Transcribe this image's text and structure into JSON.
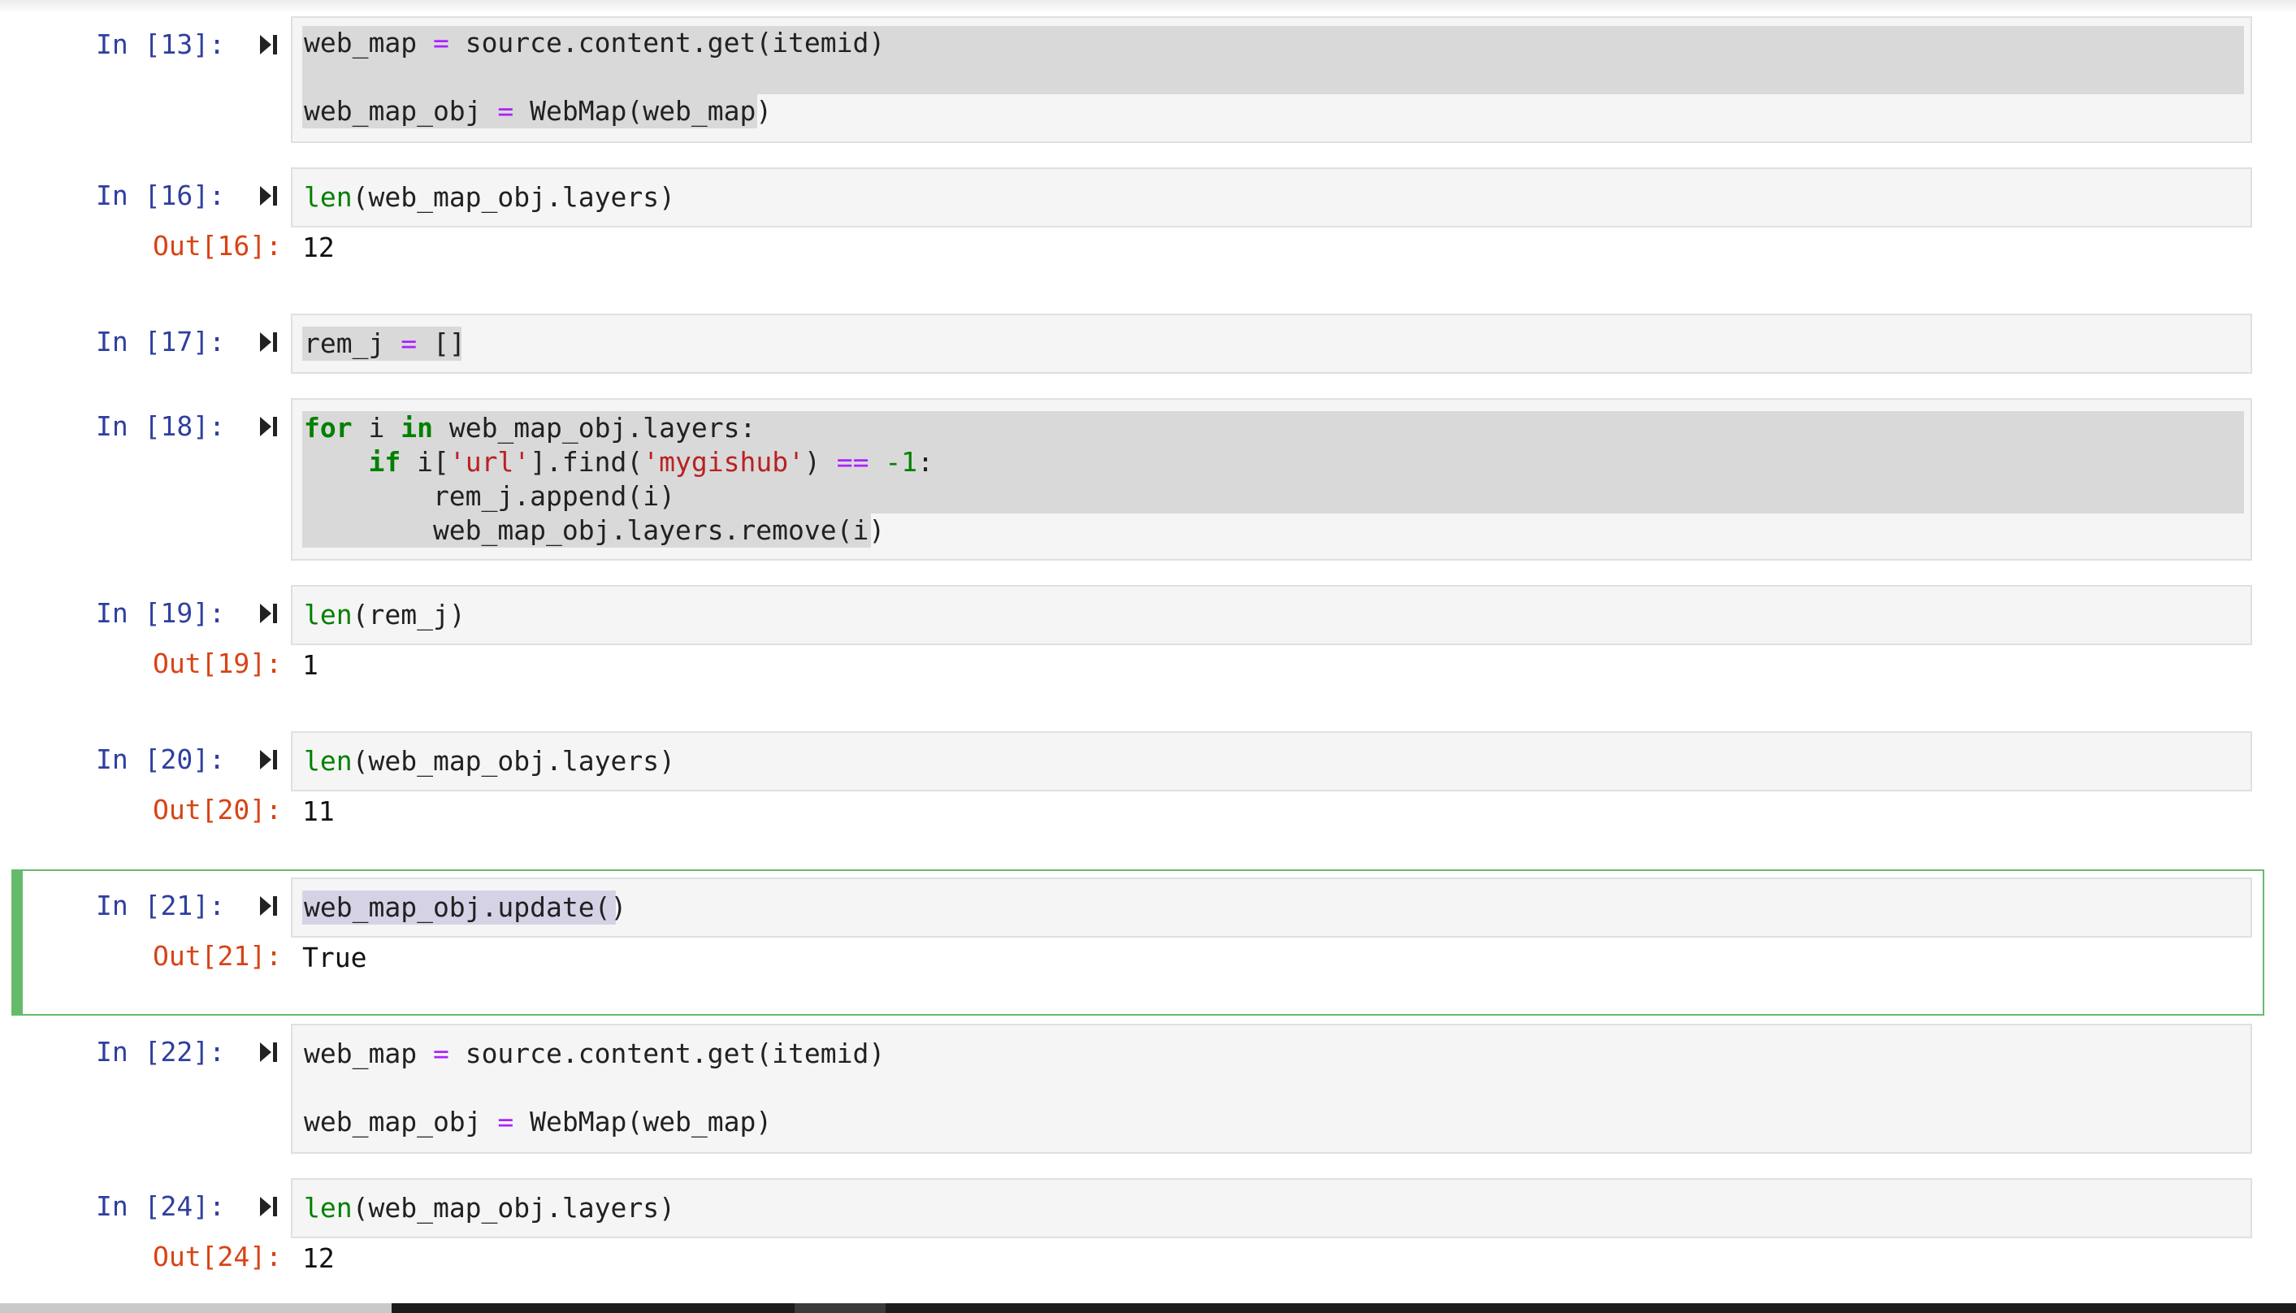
{
  "cells": [
    {
      "in_prompt": "In [13]:",
      "lines": [
        [
          [
            "web_map ",
            ""
          ],
          [
            "=",
            "op"
          ],
          [
            " source.content.get(itemid)",
            ""
          ]
        ],
        [
          [
            "",
            ""
          ]
        ],
        [
          [
            "web_map_obj ",
            ""
          ],
          [
            "=",
            "op"
          ],
          [
            " WebMap(web_map)",
            ""
          ]
        ]
      ]
    },
    {
      "in_prompt": "In [16]:",
      "lines": [
        [
          [
            "len",
            "bi"
          ],
          [
            "(web_map_obj.layers)",
            ""
          ]
        ]
      ],
      "out_prompt": "Out[16]:",
      "output": "12"
    },
    {
      "in_prompt": "In [17]:",
      "lines": [
        [
          [
            "rem_j ",
            ""
          ],
          [
            "=",
            "op"
          ],
          [
            " []",
            ""
          ]
        ]
      ]
    },
    {
      "in_prompt": "In [18]:",
      "lines": [
        [
          [
            "for",
            "kw"
          ],
          [
            " i ",
            ""
          ],
          [
            "in",
            "kw"
          ],
          [
            " web_map_obj.layers:",
            ""
          ]
        ],
        [
          [
            "    ",
            ""
          ],
          [
            "if",
            "kw"
          ],
          [
            " i[",
            ""
          ],
          [
            "'url'",
            "str"
          ],
          [
            "].find(",
            ""
          ],
          [
            "'mygishub'",
            "str"
          ],
          [
            ") ",
            ""
          ],
          [
            "==",
            "op"
          ],
          [
            " ",
            ""
          ],
          [
            "-1",
            "num"
          ],
          [
            ":",
            ""
          ]
        ],
        [
          [
            "        rem_j.append(i)",
            ""
          ]
        ],
        [
          [
            "        web_map_obj.layers.remove(i)",
            ""
          ]
        ]
      ]
    },
    {
      "in_prompt": "In [19]:",
      "lines": [
        [
          [
            "len",
            "bi"
          ],
          [
            "(rem_j)",
            ""
          ]
        ]
      ],
      "out_prompt": "Out[19]:",
      "output": "1"
    },
    {
      "in_prompt": "In [20]:",
      "lines": [
        [
          [
            "len",
            "bi"
          ],
          [
            "(web_map_obj.layers)",
            ""
          ]
        ]
      ],
      "out_prompt": "Out[20]:",
      "output": "11"
    },
    {
      "in_prompt": "In [21]:",
      "lines": [
        [
          [
            "web_map_obj.update()",
            ""
          ]
        ]
      ],
      "out_prompt": "Out[21]:",
      "output": "True"
    },
    {
      "in_prompt": "In [22]:",
      "lines": [
        [
          [
            "web_map ",
            ""
          ],
          [
            "=",
            "op"
          ],
          [
            " source.content.get(itemid)",
            ""
          ]
        ],
        [
          [
            "",
            ""
          ]
        ],
        [
          [
            "web_map_obj ",
            ""
          ],
          [
            "=",
            "op"
          ],
          [
            " WebMap(web_map)",
            ""
          ]
        ]
      ]
    },
    {
      "in_prompt": "In [24]:",
      "lines": [
        [
          [
            "len",
            "bi"
          ],
          [
            "(web_map_obj.layers)",
            ""
          ]
        ]
      ],
      "out_prompt": "Out[24]:",
      "output": "12"
    }
  ],
  "colors": {
    "in_prompt": "#303f9f",
    "out_prompt": "#d84315",
    "selected_cell_border": "#66bb6a",
    "operator": "#aa22ff",
    "keyword": "#008000",
    "string": "#ba2121"
  },
  "icons": {
    "run": "run-cell-icon"
  }
}
